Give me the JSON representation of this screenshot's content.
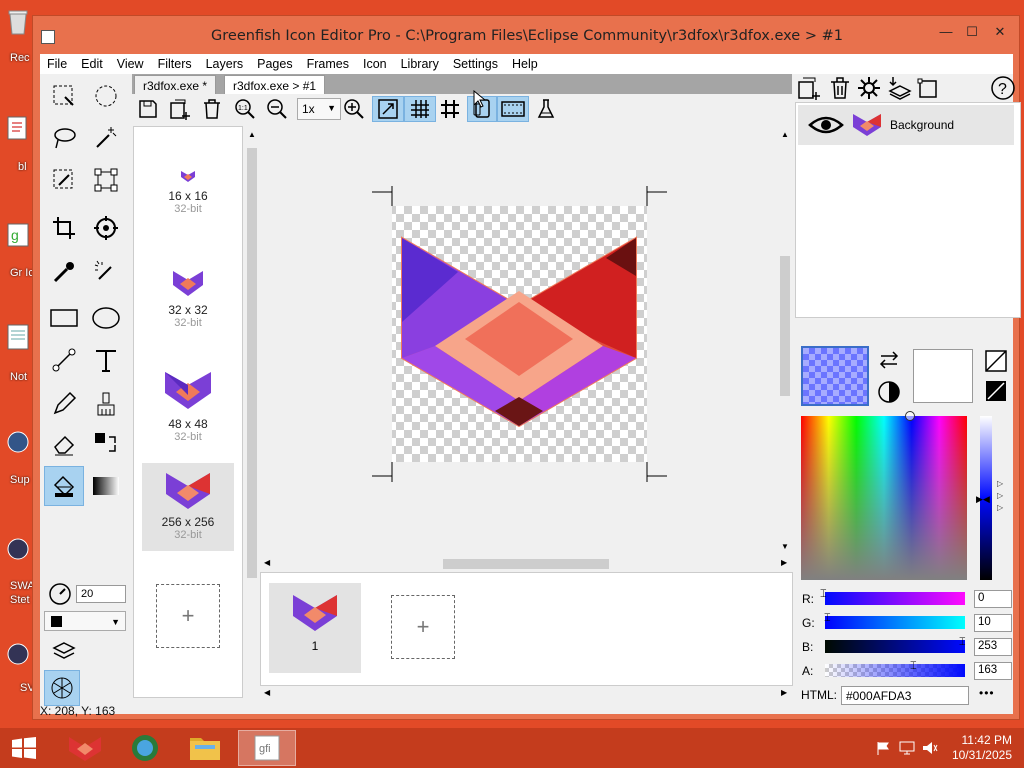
{
  "window": {
    "title": "Greenfish Icon Editor Pro - C:\\Program Files\\Eclipse Community\\r3dfox\\r3dfox.exe > #1",
    "minimize": "—",
    "maximize": "☐",
    "close": "✕"
  },
  "menu": [
    "File",
    "Edit",
    "View",
    "Filters",
    "Layers",
    "Pages",
    "Frames",
    "Icon",
    "Library",
    "Settings",
    "Help"
  ],
  "tabs": [
    "r3dfox.exe *",
    "r3dfox.exe > #1"
  ],
  "toolbar": {
    "zoom": "1x"
  },
  "tool_options": {
    "size": "20"
  },
  "pages": [
    {
      "size": "16 x 16",
      "bits": "32-bit"
    },
    {
      "size": "32 x 32",
      "bits": "32-bit"
    },
    {
      "size": "48 x 48",
      "bits": "32-bit"
    },
    {
      "size": "256 x 256",
      "bits": "32-bit"
    }
  ],
  "add_symbol": "+",
  "frames": [
    {
      "label": "1"
    }
  ],
  "layers": [
    {
      "name": "Background"
    }
  ],
  "color": {
    "channels": [
      {
        "label": "R:",
        "value": "0"
      },
      {
        "label": "G:",
        "value": "10"
      },
      {
        "label": "B:",
        "value": "253"
      },
      {
        "label": "A:",
        "value": "163"
      }
    ],
    "html_label": "HTML:",
    "html_value": "#000AFDA3",
    "more": "•••",
    "primary": "#000AFD",
    "secondary": "#ffffff"
  },
  "status": {
    "coords": "X: 208, Y: 163"
  },
  "desktop": {
    "labels": [
      "Rec",
      "bl",
      "Gr Ico",
      "Not",
      "Sup",
      "SWA Stet",
      "SV"
    ]
  },
  "taskbar": {
    "time": "11:42 PM",
    "date": "10/31/2025"
  }
}
